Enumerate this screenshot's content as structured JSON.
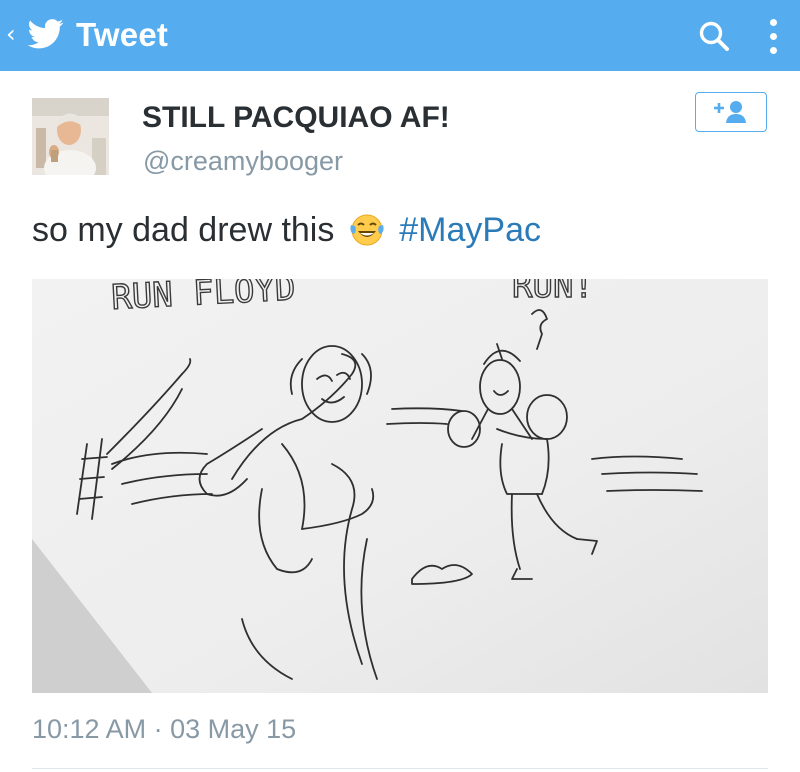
{
  "appbar": {
    "title": "Tweet",
    "back_icon": "chevron-left-icon",
    "logo_icon": "twitter-bird-icon",
    "search_icon": "search-icon",
    "menu_icon": "overflow-menu-icon",
    "color": "#55acee"
  },
  "author": {
    "display_name": "STILL PACQUIAO AF!",
    "handle": "@creamybooger",
    "avatar_icon": "avatar",
    "follow_icon": "add-user-icon"
  },
  "tweet": {
    "text": "so my dad drew this",
    "emoji": "face-with-tears-of-joy",
    "hashtag": "#MayPac",
    "hashtag_color": "#2b7bb9",
    "media_text_left": "RUN FLOYD",
    "media_text_right": "RUN!",
    "timestamp": "10:12 AM · 03 May 15"
  }
}
